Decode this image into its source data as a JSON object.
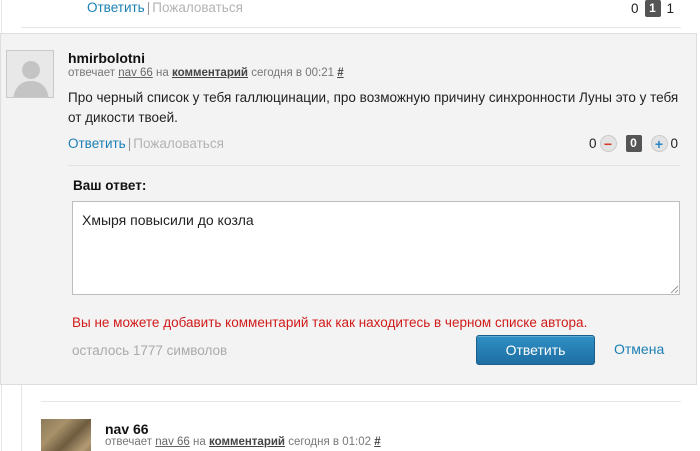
{
  "top": {
    "reply_label": "Ответить",
    "separator": "|",
    "complain_label": "Пожаловаться",
    "vote_minus_count": "0",
    "vote_score": "1",
    "vote_plus_count": "1"
  },
  "comment": {
    "author": "hmirbolotni",
    "meta_replies": "отвечает",
    "meta_target_user": "nav 66",
    "meta_on": "на",
    "meta_comment_link": "комментарий",
    "meta_time": "сегодня в 00:21",
    "meta_hash": "#",
    "text": "Про черный список у тебя галлюцинации, про возможную причину синхронности Луны это у тебя от дикости твоей.",
    "reply_label": "Ответить",
    "separator": "|",
    "complain_label": "Пожаловаться",
    "vote_minus_count": "0",
    "vote_minus_icon": "−",
    "vote_score": "0",
    "vote_plus_icon": "+",
    "vote_plus_count": "0"
  },
  "reply_form": {
    "label": "Ваш ответ:",
    "textarea_value": "Хмыря повысили до козла",
    "error": "Вы не можете добавить комментарий так как находитесь в черном списке автора.",
    "chars_left": "осталось 1777 символов",
    "submit_label": "Ответить",
    "cancel_label": "Отмена"
  },
  "next_comment": {
    "author": "nav 66",
    "meta_replies": "отвечает",
    "meta_target_user": "nav 66",
    "meta_on": "на",
    "meta_comment_link": "комментарий",
    "meta_time": "сегодня в 01:02",
    "meta_hash": "#"
  },
  "colors": {
    "accent": "#1b7fb5",
    "error": "#d11a1a",
    "card_bg": "#f3f3f3"
  }
}
